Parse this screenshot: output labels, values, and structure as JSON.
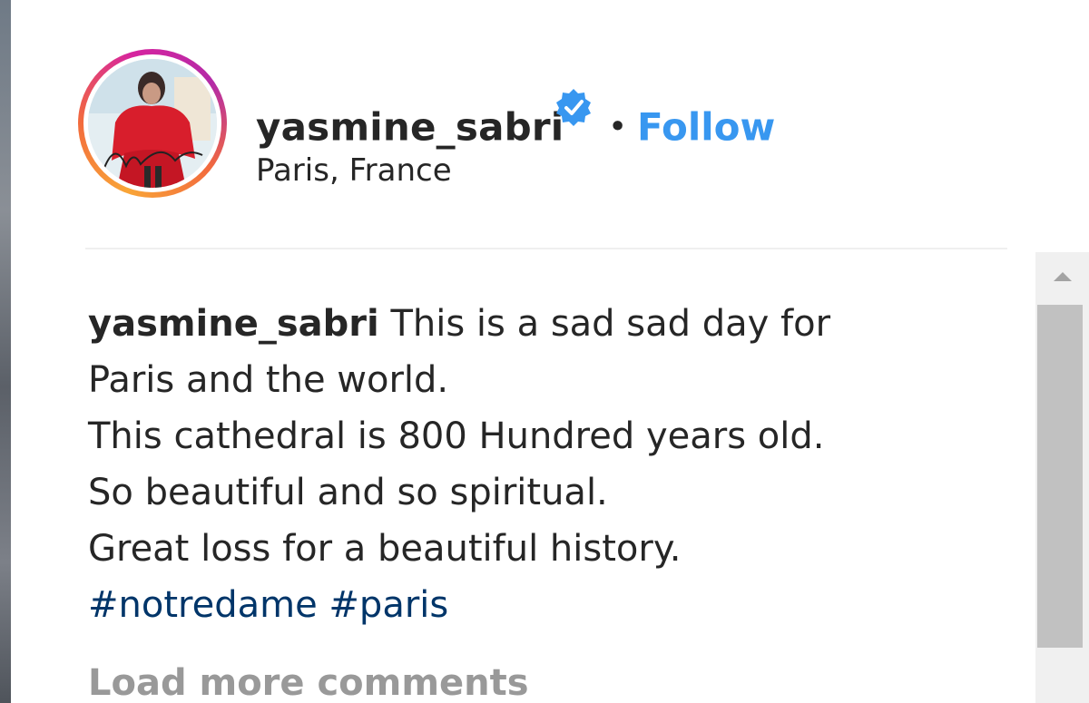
{
  "post": {
    "username": "yasmine_sabri",
    "separator": "•",
    "follow_label": "Follow",
    "location": "Paris, France",
    "verified_icon": "verified-badge-icon"
  },
  "caption": {
    "username": "yasmine_sabri",
    "lines": [
      "This is a sad sad day for",
      "Paris and the world.",
      "This cathedral is 800 Hundred years old.",
      "So beautiful and so spiritual.",
      "Great loss for a beautiful history."
    ],
    "hashtags": [
      "#notredame",
      "#paris"
    ]
  },
  "comments": {
    "load_more_label": "Load more comments"
  },
  "colors": {
    "link_blue": "#3897f0",
    "hashtag": "#003569",
    "text": "#262626",
    "muted": "#999999"
  }
}
